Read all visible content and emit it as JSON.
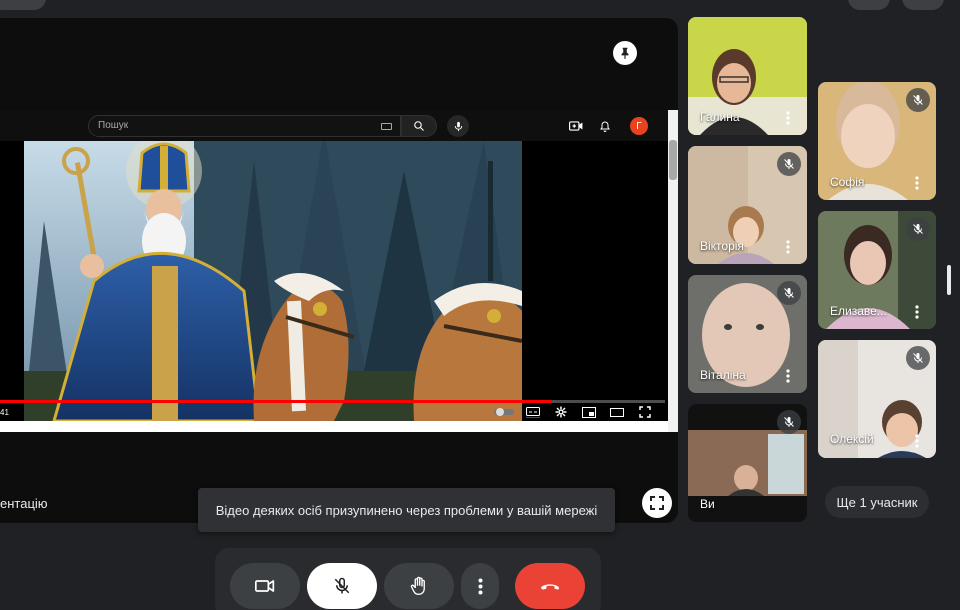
{
  "presentation": {
    "label": "ентацію",
    "youtube": {
      "search_placeholder": "Пошук",
      "avatar_letter": "Г",
      "time": "41",
      "progress_fraction": 0.83
    }
  },
  "notification": {
    "text": "Відео деяких осіб призупинено через проблеми у вашій мережі"
  },
  "participants": [
    {
      "name": "Галина"
    },
    {
      "name": "Вікторія"
    },
    {
      "name": "Віталіна"
    },
    {
      "name": "Ви"
    },
    {
      "name": "Софія"
    },
    {
      "name": "Елизаве..."
    },
    {
      "name": "Олексій"
    }
  ],
  "more_participants": "Ще 1 учасник",
  "colors": {
    "background": "#202124",
    "end_call": "#ea4335",
    "active_speaker": "#8ab4f8",
    "youtube_red": "#ff0000"
  }
}
